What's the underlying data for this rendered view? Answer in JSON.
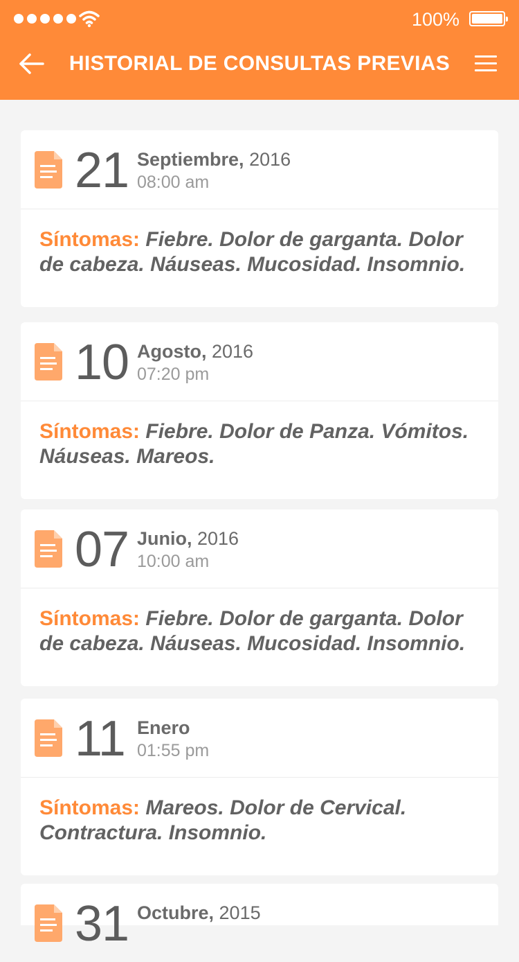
{
  "status_bar": {
    "battery_percent": "100%",
    "signal_dots": 5
  },
  "header": {
    "title": "HISTORIAL DE CONSULTAS PREVIAS",
    "back_icon": "arrow-left-icon",
    "menu_icon": "hamburger-menu-icon"
  },
  "colors": {
    "accent": "#ff8a38",
    "icon_fill": "#ffa86b",
    "background": "#f4f4f4",
    "text_dark": "#5c5c5c"
  },
  "consultations": [
    {
      "day": "21",
      "month": "Septiembre,",
      "year": " 2016",
      "time": "08:00 am",
      "symptoms_label": "Síntomas:",
      "symptoms": "Fiebre. Dolor de garganta. Dolor de cabeza. Náuseas. Mucosidad. Insomnio."
    },
    {
      "day": "10",
      "month": "Agosto,",
      "year": " 2016",
      "time": "07:20 pm",
      "symptoms_label": "Síntomas:",
      "symptoms": "Fiebre. Dolor de Panza. Vómitos. Náuseas. Mareos."
    },
    {
      "day": "07",
      "month": "Junio,",
      "year": " 2016",
      "time": "10:00 am",
      "symptoms_label": "Síntomas:",
      "symptoms": "Fiebre. Dolor de garganta. Dolor de cabeza. Náuseas. Mucosidad. Insomnio."
    },
    {
      "day": "11",
      "month": "Enero",
      "year": "",
      "time": " 01:55 pm",
      "symptoms_label": "Síntomas:",
      "symptoms": "Mareos. Dolor de Cervical. Contractura. Insomnio."
    },
    {
      "day": "31",
      "month": "Octubre,",
      "year": " 2015",
      "time": "",
      "symptoms_label": "",
      "symptoms": ""
    }
  ]
}
